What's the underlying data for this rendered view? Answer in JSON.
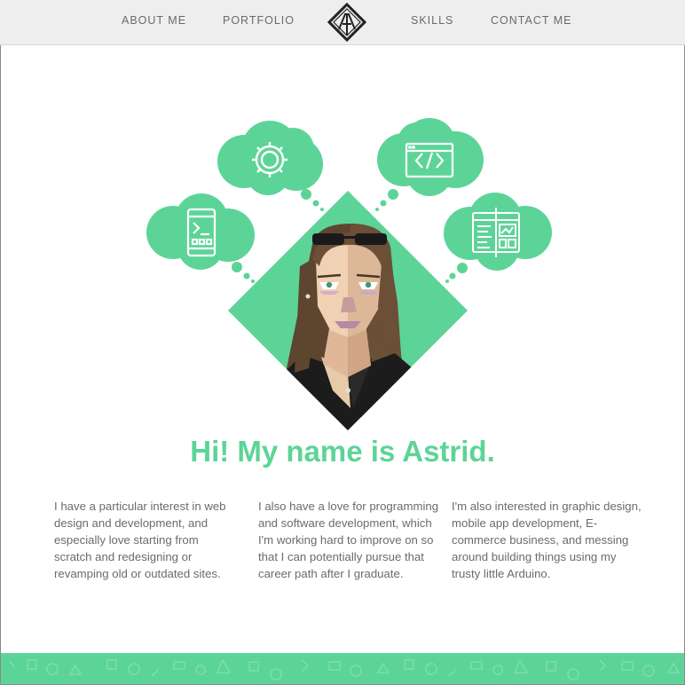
{
  "nav": {
    "items": [
      {
        "label": "ABOUT ME"
      },
      {
        "label": "PORTFOLIO"
      },
      {
        "label": "SKILLS"
      },
      {
        "label": "CONTACT ME"
      }
    ],
    "logo_icon": "diamond-monogram-logo-icon"
  },
  "hero": {
    "icons": [
      "gear-icon",
      "code-window-icon",
      "mobile-terminal-icon",
      "web-layout-icon"
    ],
    "illustration": "portrait-illustration"
  },
  "headline": "Hi! My name is Astrid.",
  "columns": [
    {
      "lines": [
        "I have a particular interest in web",
        "design and development, and",
        "especially love starting from",
        "scratch and redesigning or",
        "revamping old or outdated sites."
      ]
    },
    {
      "lines": [
        "I also have a love for programming",
        "and software development, which",
        "I'm working hard to improve on so",
        "that I can potentially pursue that",
        "career path after I graduate."
      ]
    },
    {
      "lines": [
        "I'm also interested in graphic design,",
        "mobile app development, E-",
        "commerce business, and messing",
        "around building things using my",
        "trusty little Arduino."
      ]
    }
  ],
  "colors": {
    "accent": "#5dd497",
    "nav_bg": "#eeeeee",
    "body_text": "#6b6b6b",
    "nav_text": "#6a6a6a"
  }
}
